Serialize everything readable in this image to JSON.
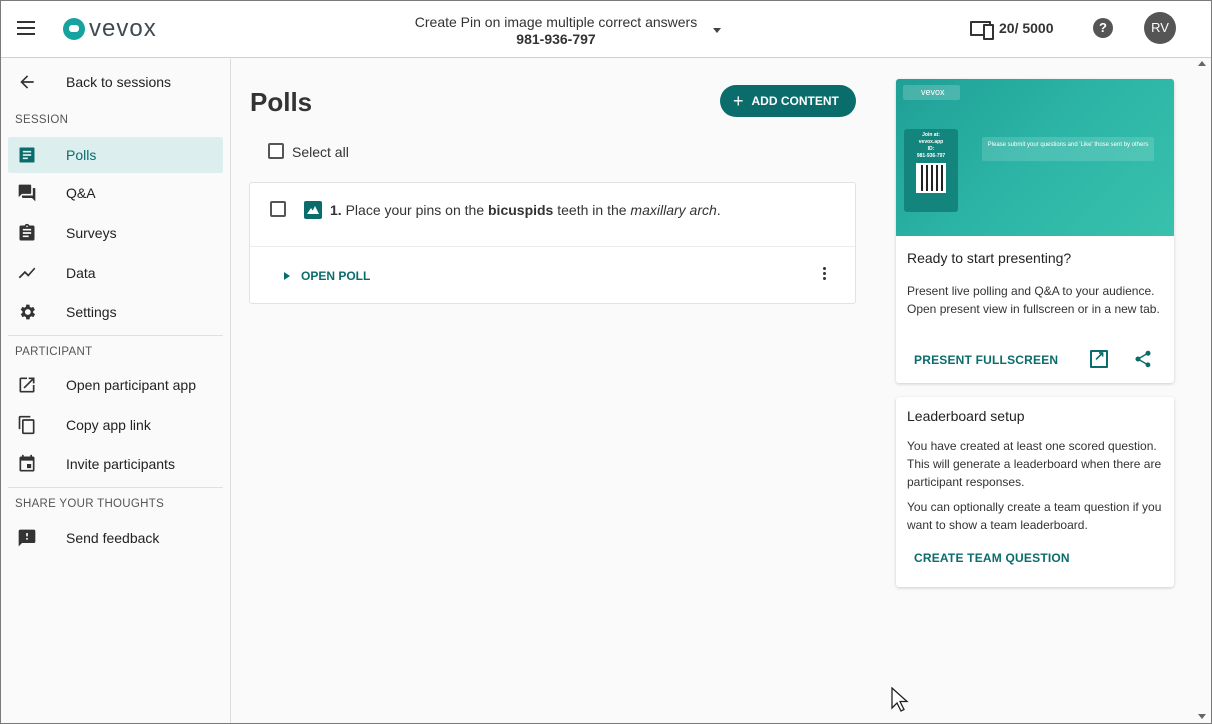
{
  "header": {
    "logo_text": "vevox",
    "session_name": "Create Pin on image multiple correct answers",
    "session_id": "981-936-797",
    "participant_count": "20/ 5000",
    "help_symbol": "?",
    "avatar_initials": "RV"
  },
  "sidebar": {
    "back_label": "Back to sessions",
    "session_section": "SESSION",
    "session_items": [
      {
        "label": "Polls",
        "icon": "poll-icon",
        "active": true
      },
      {
        "label": "Q&A",
        "icon": "forum-icon"
      },
      {
        "label": "Surveys",
        "icon": "clipboard-icon"
      },
      {
        "label": "Data",
        "icon": "chart-line-icon"
      },
      {
        "label": "Settings",
        "icon": "gear-icon"
      }
    ],
    "participant_section": "PARTICIPANT",
    "participant_items": [
      {
        "label": "Open participant app",
        "icon": "open-in-new-icon"
      },
      {
        "label": "Copy app link",
        "icon": "copy-icon"
      },
      {
        "label": "Invite participants",
        "icon": "calendar-icon"
      }
    ],
    "feedback_section": "SHARE YOUR THOUGHTS",
    "feedback_items": [
      {
        "label": "Send feedback",
        "icon": "feedback-icon"
      }
    ]
  },
  "main": {
    "title": "Polls",
    "add_content_label": "ADD CONTENT",
    "select_all_label": "Select all",
    "polls": [
      {
        "number": "1.",
        "text_before": "Place your pins on the ",
        "text_bold": "bicuspids",
        "text_middle": " teeth in the ",
        "text_italic": "maxillary arch",
        "text_after": ".",
        "open_label": "OPEN POLL"
      }
    ]
  },
  "present_card": {
    "preview_logo": "vevox",
    "preview_join_label": "Join at:",
    "preview_join_url": "vevox.app",
    "preview_id_label": "ID:",
    "preview_id": "981-936-797",
    "preview_message": "Please submit your questions and 'Like' those sent by others",
    "title": "Ready to start presenting?",
    "body": "Present live polling and Q&A to your audience. Open present view in fullscreen or in a new tab.",
    "action_label": "PRESENT FULLSCREEN"
  },
  "leaderboard_card": {
    "title": "Leaderboard setup",
    "body_1": "You have created at least one scored question. This will generate a leaderboard when there are participant responses.",
    "body_2": "You can optionally create a team question if you want to show a team leaderboard.",
    "action_label": "CREATE TEAM QUESTION"
  },
  "colors": {
    "brand": "#0b6c6c",
    "accent": "#16a3a0",
    "active_nav_bg": "#dcefee"
  }
}
